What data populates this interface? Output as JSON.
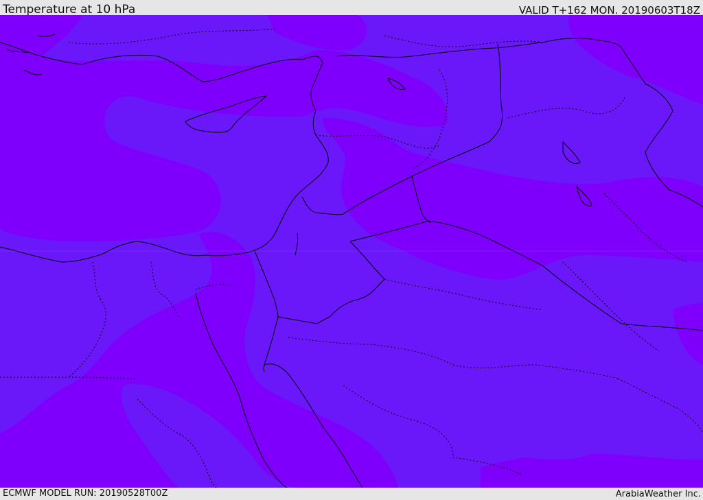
{
  "header": {
    "title": "Temperature at 10 hPa",
    "valid": "VALID T+162 MON. 20190603T18Z"
  },
  "footer": {
    "model_run": "ECMWF MODEL RUN: 20190528T00Z",
    "credit": "ArabiaWeather Inc."
  },
  "map": {
    "colors": {
      "bands_warm": "#6a17f9",
      "bands_cold": "#7e00fc",
      "coastline": "#000000",
      "border": "#000000"
    }
  }
}
